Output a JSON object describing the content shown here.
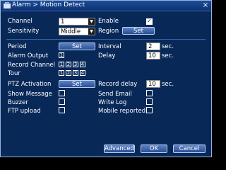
{
  "window": {
    "title": "Alarm > Motion Detect"
  },
  "channel": {
    "label": "Channel",
    "value": "1"
  },
  "enable": {
    "label": "Enable",
    "checked": true
  },
  "sensitivity": {
    "label": "Sensitivity",
    "value": "Middle"
  },
  "region": {
    "label": "Region",
    "button": "Set"
  },
  "period": {
    "label": "Period",
    "button": "Set"
  },
  "interval": {
    "label": "Interval",
    "value": "2",
    "unit": "sec."
  },
  "alarm_output": {
    "label": "Alarm Output",
    "channels": [
      "1"
    ]
  },
  "delay": {
    "label": "Delay",
    "value": "10",
    "unit": "sec."
  },
  "record_channel": {
    "label": "Record Channel",
    "channels": [
      "1",
      "2",
      "3",
      "4"
    ]
  },
  "tour": {
    "label": "Tour",
    "channels": [
      "1",
      "2",
      "3",
      "4"
    ]
  },
  "ptz_activation": {
    "label": "PTZ Activation",
    "button": "Set"
  },
  "record_delay": {
    "label": "Record delay",
    "value": "10",
    "unit": "sec."
  },
  "show_message": {
    "label": "Show Message"
  },
  "send_email": {
    "label": "Send Email"
  },
  "buzzer": {
    "label": "Buzzer"
  },
  "write_log": {
    "label": "Write Log"
  },
  "ftp_upload": {
    "label": "FTP upload"
  },
  "mobile_reported": {
    "label": "Mobile reported"
  },
  "footer": {
    "advanced": "Advanced",
    "ok": "OK",
    "cancel": "Cancel"
  }
}
